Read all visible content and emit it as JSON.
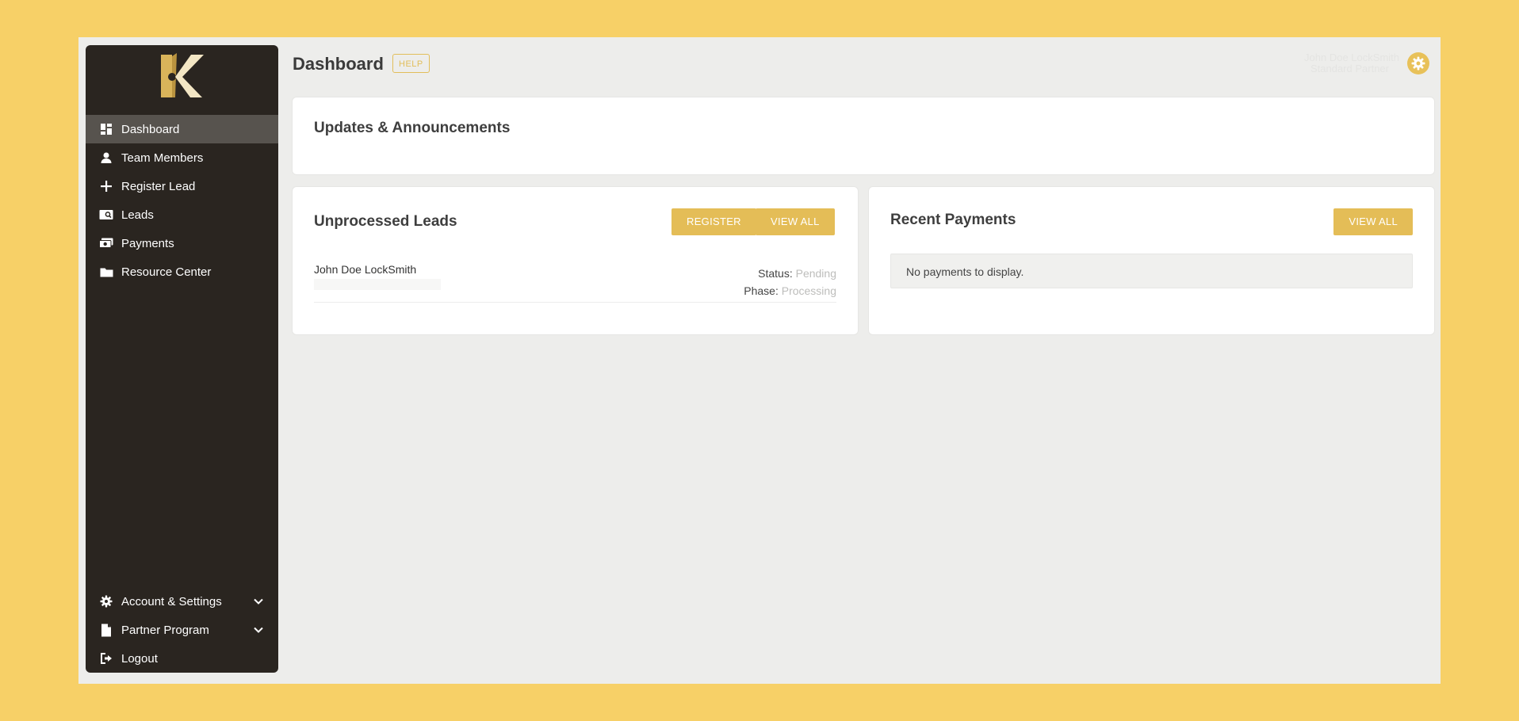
{
  "page": {
    "title": "Dashboard",
    "help_label": "HELP"
  },
  "user": {
    "name": "John Doe LockSmith",
    "role": "Standard Partner"
  },
  "sidebar": {
    "items": [
      {
        "label": "Dashboard",
        "icon": "dashboard-icon",
        "active": true
      },
      {
        "label": "Team Members",
        "icon": "person-icon"
      },
      {
        "label": "Register Lead",
        "icon": "plus-icon"
      },
      {
        "label": "Leads",
        "icon": "search-card-icon"
      },
      {
        "label": "Payments",
        "icon": "money-icon"
      },
      {
        "label": "Resource Center",
        "icon": "folder-icon"
      }
    ],
    "bottom": [
      {
        "label": "Account & Settings",
        "icon": "gear-icon"
      },
      {
        "label": "Partner Program",
        "icon": "document-icon"
      },
      {
        "label": "Logout",
        "icon": "logout-icon"
      }
    ]
  },
  "announcements": {
    "title": "Updates & Announcements"
  },
  "leads": {
    "title": "Unprocessed Leads",
    "register_label": "REGISTER",
    "view_all_label": "VIEW ALL",
    "items": [
      {
        "name": "John Doe LockSmith",
        "status_label": "Status:",
        "status": "Pending",
        "phase_label": "Phase:",
        "phase": "Processing"
      }
    ]
  },
  "payments": {
    "title": "Recent Payments",
    "view_all_label": "VIEW ALL",
    "empty_text": "No payments to display."
  },
  "colors": {
    "accent": "#E4BD57",
    "sidebar": "#2A2520",
    "background": "#F7D067"
  }
}
